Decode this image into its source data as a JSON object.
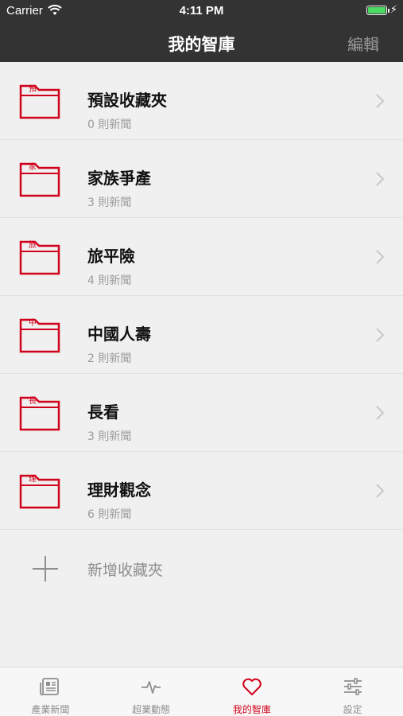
{
  "status_bar": {
    "carrier": "Carrier",
    "time": "4:11 PM"
  },
  "nav": {
    "title": "我的智庫",
    "edit_label": "編輯"
  },
  "folders": [
    {
      "icon_char": "預",
      "title": "預設收藏夾",
      "count": "0 則新聞"
    },
    {
      "icon_char": "家",
      "title": "家族爭產",
      "count": "3 則新聞"
    },
    {
      "icon_char": "旅",
      "title": "旅平險",
      "count": "4 則新聞"
    },
    {
      "icon_char": "中",
      "title": "中國人壽",
      "count": "2 則新聞"
    },
    {
      "icon_char": "長",
      "title": "長看",
      "count": "3 則新聞"
    },
    {
      "icon_char": "理",
      "title": "理財觀念",
      "count": "6 則新聞"
    }
  ],
  "add_folder_label": "新增收藏夾",
  "tabs": [
    {
      "label": "產業新聞",
      "icon": "newspaper-icon"
    },
    {
      "label": "超業動態",
      "icon": "pulse-icon"
    },
    {
      "label": "我的智庫",
      "icon": "heart-icon",
      "active": true
    },
    {
      "label": "設定",
      "icon": "sliders-icon"
    }
  ],
  "colors": {
    "accent": "#d0021b",
    "bar": "#333333",
    "background": "#f0f0f0"
  }
}
